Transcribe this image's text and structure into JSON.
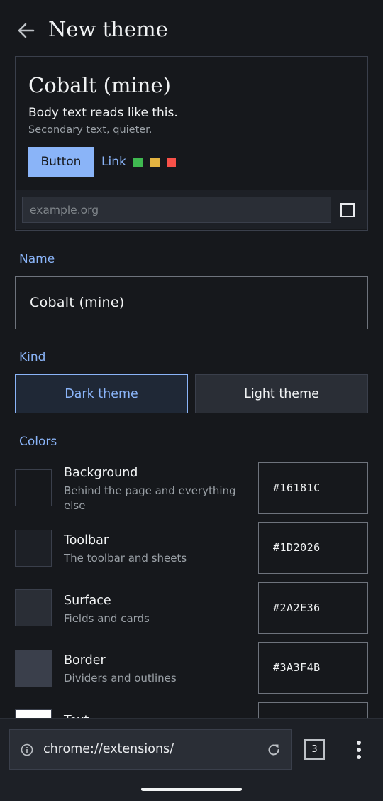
{
  "header": {
    "title": "New theme",
    "back_icon": "arrow-left-icon"
  },
  "preview": {
    "title": "Cobalt (mine)",
    "body_text": "Body text reads like this.",
    "secondary_text": "Secondary text, quieter.",
    "button_label": "Button",
    "link_label": "Link",
    "status_colors": [
      "#3fb950",
      "#e3b341",
      "#f85149"
    ],
    "url_placeholder": "example.org"
  },
  "name_section": {
    "label": "Name",
    "value": "Cobalt (mine)"
  },
  "kind_section": {
    "label": "Kind",
    "options": [
      "Dark theme",
      "Light theme"
    ],
    "selected": "Dark theme"
  },
  "colors_section": {
    "label": "Colors",
    "items": [
      {
        "name": "Background",
        "description": "Behind the page and everything else",
        "hex": "#16181C"
      },
      {
        "name": "Toolbar",
        "description": "The toolbar and sheets",
        "hex": "#1D2026"
      },
      {
        "name": "Surface",
        "description": "Fields and cards",
        "hex": "#2A2E36"
      },
      {
        "name": "Border",
        "description": "Dividers and outlines",
        "hex": "#3A3F4B"
      },
      {
        "name": "Text",
        "description": "",
        "hex": ""
      }
    ]
  },
  "browser": {
    "url": "chrome://extensions/",
    "tab_count": "3",
    "accent": "#8ab4f8"
  }
}
